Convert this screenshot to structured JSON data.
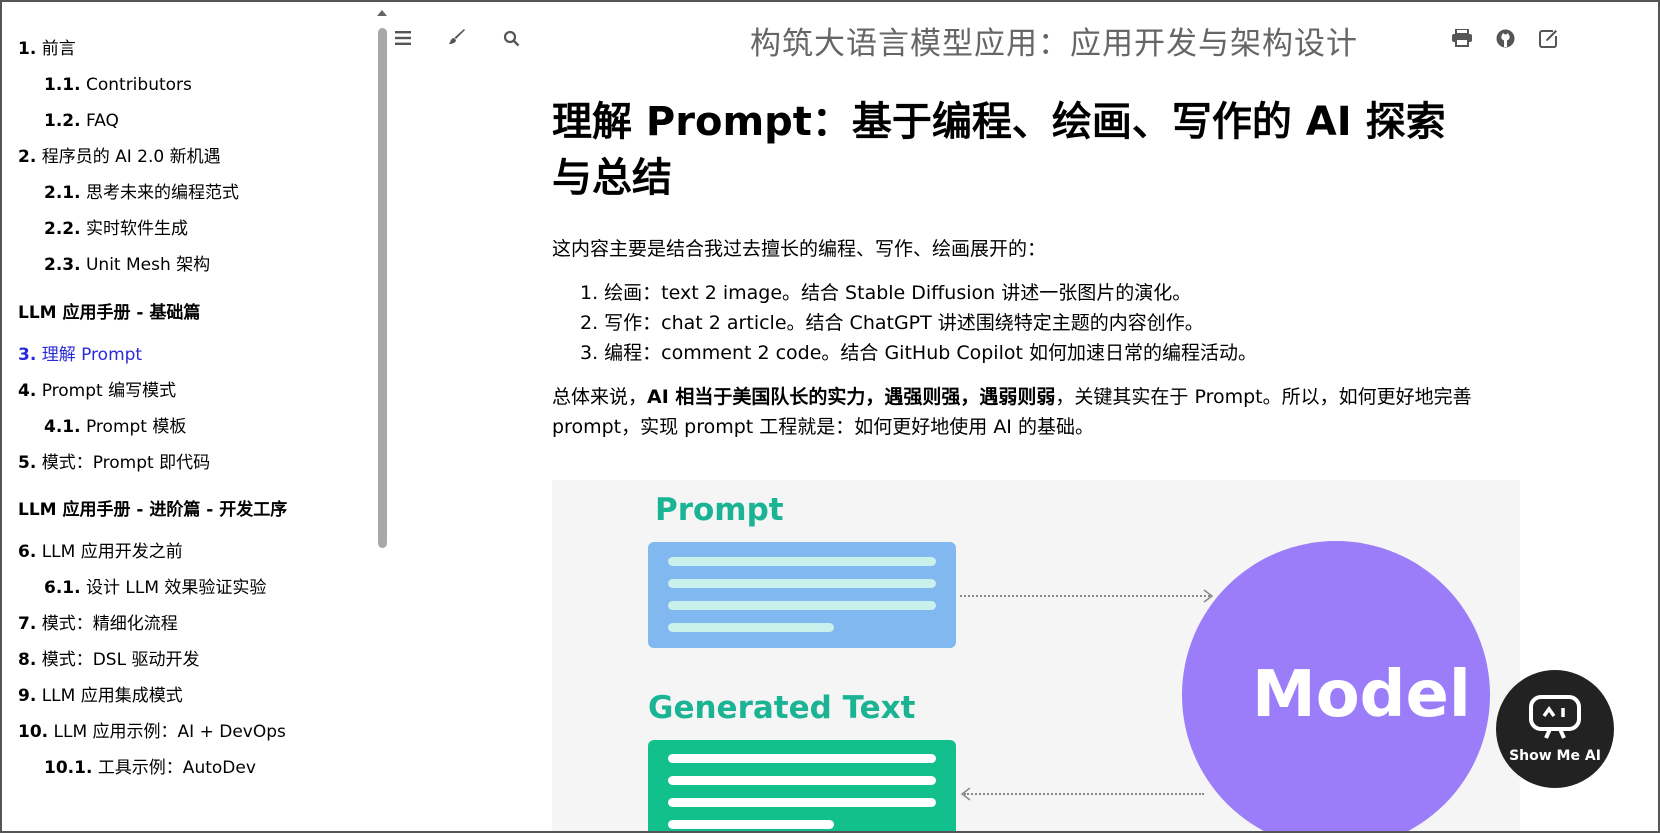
{
  "sidebar": {
    "items": [
      {
        "num": "1.",
        "label": "前言",
        "level": 1
      },
      {
        "num": "1.1.",
        "label": "Contributors",
        "level": 2
      },
      {
        "num": "1.2.",
        "label": "FAQ",
        "level": 2
      },
      {
        "num": "2.",
        "label": "程序员的 AI 2.0 新机遇",
        "level": 1
      },
      {
        "num": "2.1.",
        "label": "思考未来的编程范式",
        "level": 2
      },
      {
        "num": "2.2.",
        "label": "实时软件生成",
        "level": 2
      },
      {
        "num": "2.3.",
        "label": "Unit Mesh 架构",
        "level": 2
      },
      {
        "part": "LLM 应用手册 - 基础篇"
      },
      {
        "num": "3.",
        "label": "理解 Prompt",
        "level": 1,
        "active": true
      },
      {
        "num": "4.",
        "label": "Prompt 编写模式",
        "level": 1
      },
      {
        "num": "4.1.",
        "label": "Prompt 模板",
        "level": 2
      },
      {
        "num": "5.",
        "label": "模式：Prompt 即代码",
        "level": 1
      },
      {
        "part": "LLM 应用手册 - 进阶篇 - 开发工序"
      },
      {
        "num": "6.",
        "label": "LLM 应用开发之前",
        "level": 1
      },
      {
        "num": "6.1.",
        "label": "设计 LLM 效果验证实验",
        "level": 2
      },
      {
        "num": "7.",
        "label": "模式：精细化流程",
        "level": 1
      },
      {
        "num": "8.",
        "label": "模式：DSL 驱动开发",
        "level": 1
      },
      {
        "num": "9.",
        "label": "LLM 应用集成模式",
        "level": 1
      },
      {
        "num": "10.",
        "label": "LLM 应用示例：AI + DevOps",
        "level": 1
      },
      {
        "num": "10.1.",
        "label": "工具示例：AutoDev",
        "level": 2
      }
    ]
  },
  "toolbar": {
    "book_title": "构筑大语言模型应用：应用开发与架构设计",
    "icons": [
      "menu-icon",
      "paintbrush-icon",
      "search-icon",
      "print-icon",
      "github-icon",
      "edit-icon"
    ]
  },
  "content": {
    "title": "理解 Prompt：基于编程、绘画、写作的 AI 探索与总结",
    "intro": "这内容主要是结合我过去擅长的编程、写作、绘画展开的：",
    "list": [
      "1. 绘画：text 2 image。结合 Stable Diffusion 讲述一张图片的演化。",
      "2. 写作：chat 2 article。结合 ChatGPT 讲述围绕特定主题的内容创作。",
      "3. 编程：comment 2 code。结合 GitHub Copilot 如何加速日常的编程活动。"
    ],
    "summary_prefix": "总体来说，",
    "summary_bold": "AI 相当于美国队长的实力，遇强则强，遇弱则弱",
    "summary_suffix": "，关键其实在于 Prompt。所以，如何更好地完善 prompt，实现 prompt 工程就是：如何更好地使用 AI 的基础。"
  },
  "figure": {
    "prompt_label": "Prompt",
    "generated_label": "Generated Text",
    "model_label": "Model",
    "colors": {
      "prompt_card": "#82b8f0",
      "prompt_bar": "#c9f0ea",
      "gen_card": "#12c08e",
      "gen_bar": "#ffffff",
      "model": "#9b7dfa",
      "label": "#1ab394"
    }
  },
  "float_button": {
    "label": "Show Me AI"
  }
}
